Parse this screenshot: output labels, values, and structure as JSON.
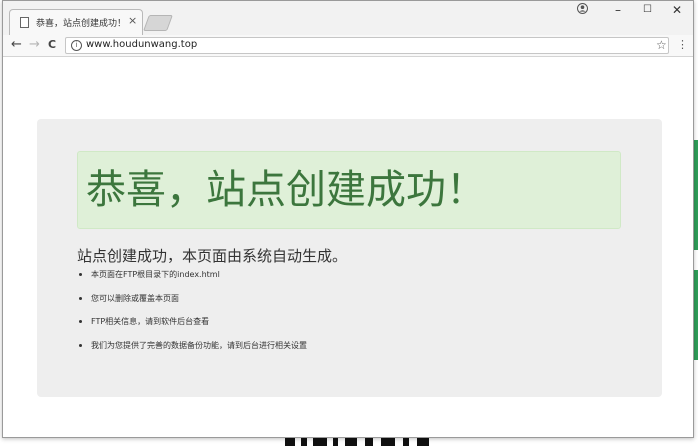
{
  "browser": {
    "tab": {
      "title": "恭喜，站点创建成功！",
      "close_glyph": "×"
    },
    "window_controls": {
      "minimize": "–",
      "maximize": "☐",
      "close": "✕"
    },
    "toolbar": {
      "back_glyph": "←",
      "forward_glyph": "→",
      "reload_glyph": "C",
      "info_glyph": "i",
      "url": "www.houdunwang.top",
      "star_glyph": "☆",
      "menu_glyph": "⋮"
    }
  },
  "page": {
    "heading": "恭喜，站点创建成功！",
    "subtitle": "站点创建成功，本页面由系统自动生成。",
    "items": [
      "本页面在FTP根目录下的index.html",
      "您可以删除或覆盖本页面",
      "FTP相关信息，请到软件后台查看",
      "我们为您提供了完善的数据备份功能，请到后台进行相关设置"
    ]
  },
  "colors": {
    "alert_background": "#dff0d8",
    "alert_text": "#3c763d",
    "panel_background": "#eeeeee"
  }
}
